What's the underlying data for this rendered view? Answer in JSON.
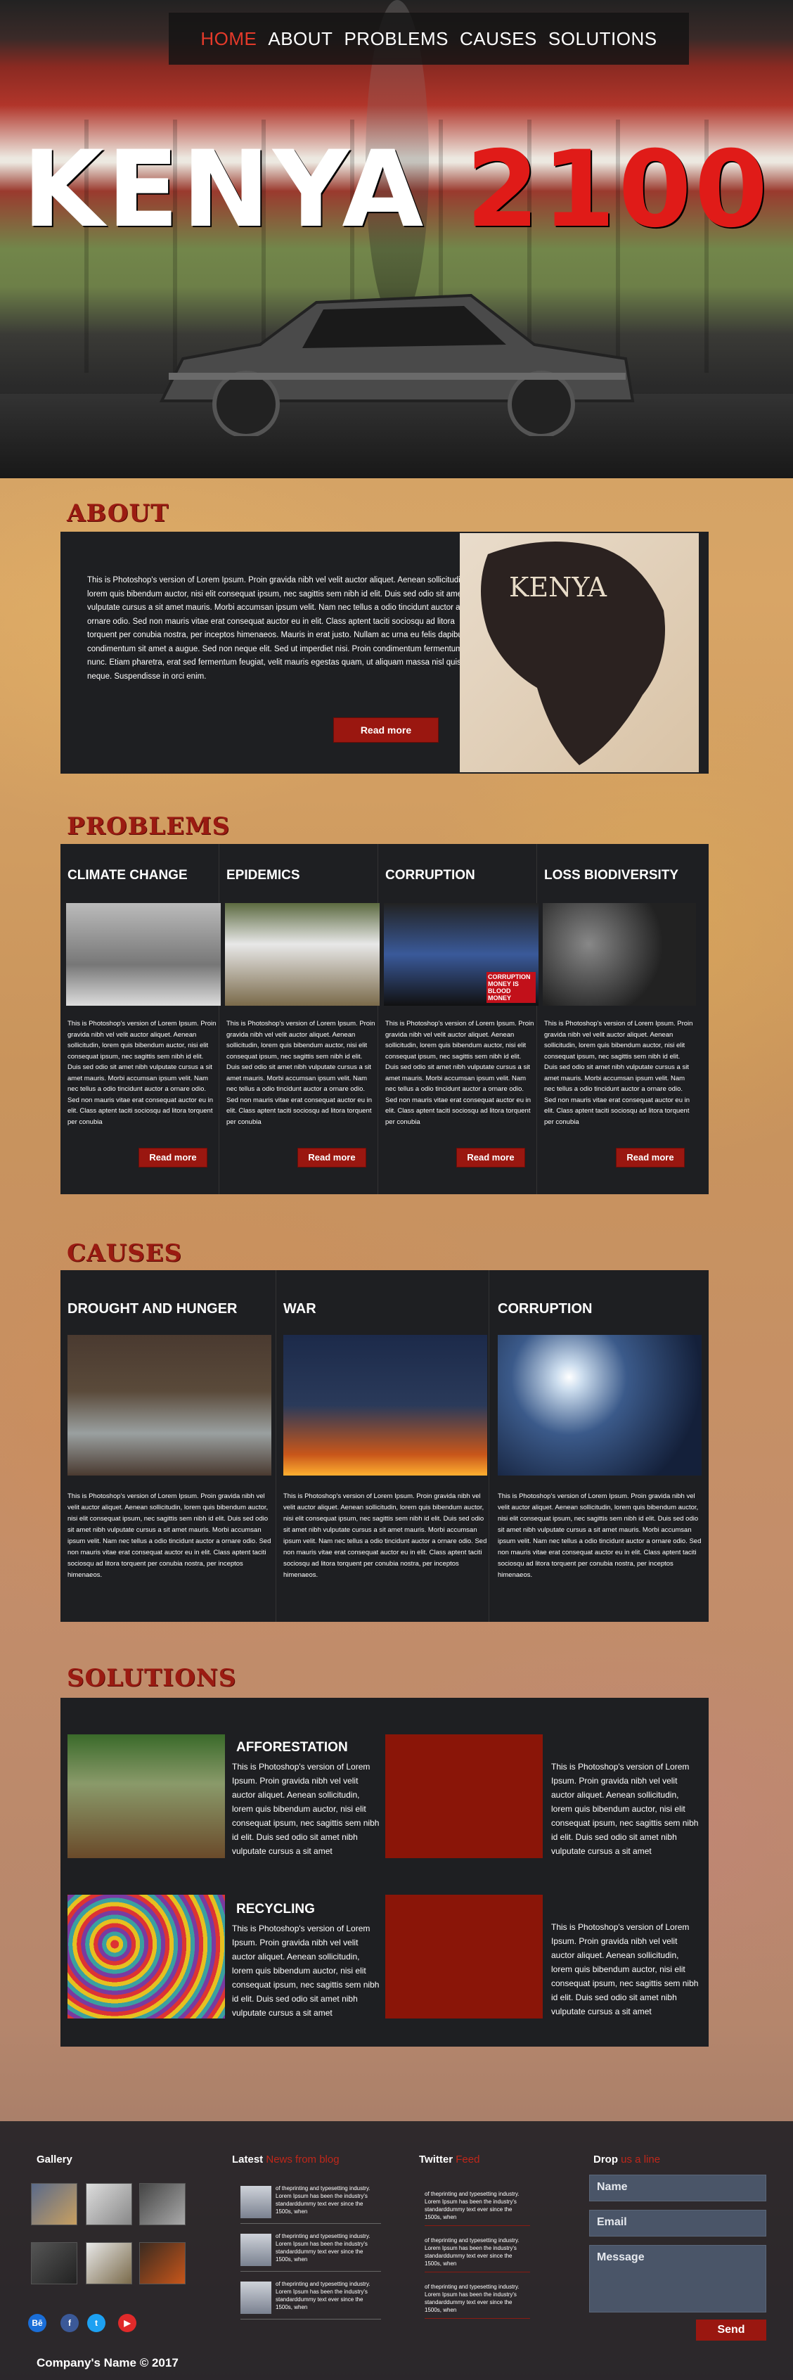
{
  "nav": {
    "items": [
      "HOME",
      "ABOUT",
      "PROBLEMS",
      "CAUSES",
      "SOLUTIONS"
    ],
    "active": "HOME"
  },
  "hero": {
    "title_white": "KENYA",
    "title_red": "2100"
  },
  "about": {
    "heading": "ABOUT",
    "text": "This is Photoshop's version  of Lorem Ipsum. Proin gravida nibh vel velit auctor aliquet. Aenean sollicitudin, lorem quis bibendum auctor, nisi elit consequat ipsum, nec sagittis sem nibh id elit. Duis sed odio sit amet nibh vulputate cursus a sit amet mauris. Morbi accumsan ipsum velit. Nam nec tellus a odio tincidunt auctor a ornare odio. Sed non mauris vitae erat consequat auctor eu in elit. Class aptent taciti sociosqu ad litora torquent per conubia nostra, per inceptos himenaeos. Mauris in erat justo. Nullam ac urna eu felis dapibus condimentum sit amet a augue. Sed non neque elit. Sed ut imperdiet nisi. Proin condimentum fermentum nunc. Etiam pharetra, erat sed fermentum feugiat, velit mauris egestas quam, ut aliquam massa nisl quis neque. Suspendisse in orci enim.",
    "button": "Read more",
    "image_caption": "KENYA"
  },
  "problems": {
    "heading": "PROBLEMS",
    "items": [
      {
        "title": "CLIMATE CHANGE",
        "text": "This is Photoshop's version  of Lorem Ipsum. Proin gravida nibh vel velit auctor aliquet. Aenean sollicitudin, lorem quis bibendum auctor, nisi elit consequat ipsum, nec sagittis sem nibh id elit. Duis sed odio sit amet nibh vulputate cursus a sit amet mauris. Morbi accumsan ipsum velit. Nam nec tellus a odio tincidunt auctor a ornare odio. Sed non  mauris vitae erat consequat auctor eu in elit. Class aptent taciti sociosqu ad litora torquent per conubia",
        "button": "Read more"
      },
      {
        "title": "EPIDEMICS",
        "text": "This is Photoshop's version  of Lorem Ipsum. Proin gravida nibh vel velit auctor aliquet. Aenean sollicitudin, lorem quis bibendum auctor, nisi elit consequat ipsum, nec sagittis sem nibh id elit. Duis sed odio sit amet nibh vulputate cursus a sit amet mauris. Morbi accumsan ipsum velit. Nam nec tellus a odio tincidunt auctor a ornare odio. Sed non  mauris vitae erat consequat auctor eu in elit. Class aptent taciti sociosqu ad litora torquent per conubia",
        "button": "Read more"
      },
      {
        "title": "CORRUPTION",
        "text": "This is Photoshop's version  of Lorem Ipsum. Proin gravida nibh vel velit auctor aliquet. Aenean sollicitudin, lorem quis bibendum auctor, nisi elit consequat ipsum, nec sagittis sem nibh id elit. Duis sed odio sit amet nibh vulputate cursus a sit amet mauris. Morbi accumsan ipsum velit. Nam nec tellus a odio tincidunt auctor a ornare odio. Sed non  mauris vitae erat consequat auctor eu in elit. Class aptent taciti sociosqu ad litora torquent per conubia",
        "button": "Read more",
        "image_text": "CORRUPTION MONEY IS BLOOD MONEY"
      },
      {
        "title": "LOSS BIODIVERSITY",
        "text": "This is Photoshop's version  of Lorem Ipsum. Proin gravida nibh vel velit auctor aliquet. Aenean sollicitudin, lorem quis bibendum auctor, nisi elit consequat ipsum, nec sagittis sem nibh id elit. Duis sed odio sit amet nibh vulputate cursus a sit amet mauris. Morbi accumsan ipsum velit. Nam nec tellus a odio tincidunt auctor a ornare odio. Sed non  mauris vitae erat consequat auctor eu in elit. Class aptent taciti sociosqu ad litora torquent per conubia",
        "button": "Read more"
      }
    ]
  },
  "causes": {
    "heading": "CAUSES",
    "items": [
      {
        "title": "DROUGHT AND HUNGER",
        "text": "This is Photoshop's version  of Lorem Ipsum. Proin gravida nibh vel velit auctor aliquet. Aenean sollicitudin, lorem quis bibendum auctor, nisi elit consequat ipsum, nec sagittis sem nibh id elit. Duis sed odio sit amet nibh vulputate cursus a sit amet mauris. Morbi accumsan ipsum velit. Nam nec tellus a odio tincidunt auctor a ornare odio. Sed non  mauris vitae erat consequat auctor eu in elit. Class aptent taciti sociosqu ad litora torquent per conubia nostra, per inceptos himenaeos."
      },
      {
        "title": "WAR",
        "text": "This is Photoshop's version  of Lorem Ipsum. Proin gravida nibh vel velit auctor aliquet. Aenean sollicitudin, lorem quis bibendum auctor, nisi elit consequat ipsum, nec sagittis sem nibh id elit. Duis sed odio sit amet nibh vulputate cursus a sit amet mauris. Morbi accumsan ipsum velit. Nam nec tellus a odio tincidunt auctor a ornare odio. Sed non  mauris vitae erat consequat auctor eu in elit. Class aptent taciti sociosqu ad litora torquent per conubia nostra, per inceptos himenaeos."
      },
      {
        "title": "CORRUPTION",
        "text": "This is Photoshop's version  of Lorem Ipsum. Proin gravida nibh vel velit auctor aliquet. Aenean sollicitudin, lorem quis bibendum auctor, nisi elit consequat ipsum, nec sagittis sem nibh id elit. Duis sed odio sit amet nibh vulputate cursus a sit amet mauris. Morbi accumsan ipsum velit. Nam nec tellus a odio tincidunt auctor a ornare odio. Sed non  mauris vitae erat consequat auctor eu in elit. Class aptent taciti sociosqu ad litora torquent per conubia nostra, per inceptos himenaeos."
      }
    ]
  },
  "solutions": {
    "heading": "SOLUTIONS",
    "items": [
      {
        "title": "AFFORESTATION",
        "text": "This is Photoshop's version  of Lorem Ipsum. Proin gravida nibh vel velit auctor aliquet. Aenean sollicitudin, lorem quis bibendum auctor, nisi elit consequat ipsum, nec sagittis sem nibh id elit. Duis sed odio sit amet nibh vulputate cursus a sit amet"
      },
      {
        "title": "RECYCLING",
        "text": "This is Photoshop's version  of Lorem Ipsum. Proin gravida nibh vel velit auctor aliquet. Aenean sollicitudin, lorem quis bibendum auctor, nisi elit consequat ipsum, nec sagittis sem nibh id elit. Duis sed odio sit amet nibh vulputate cursus a sit amet"
      }
    ],
    "side_texts": [
      "This is Photoshop's version  of Lorem Ipsum. Proin gravida nibh vel velit auctor aliquet. Aenean sollicitudin, lorem quis bibendum auctor, nisi elit consequat ipsum, nec sagittis sem nibh id elit. Duis sed odio sit amet nibh vulputate cursus a sit amet",
      "This is Photoshop's version  of Lorem Ipsum. Proin gravida nibh vel velit auctor aliquet. Aenean sollicitudin, lorem quis bibendum auctor, nisi elit consequat ipsum, nec sagittis sem nibh id elit. Duis sed odio sit amet nibh vulputate cursus a sit amet"
    ]
  },
  "footer": {
    "gallery_title": "Gallery",
    "latest_title": "Latest",
    "latest_accent": "News from blog",
    "latest_posts": [
      "of theprinting and typesetting industry. Lorem Ipsum has been the industry's standarddummy text ever since the 1500s, when",
      "of theprinting and typesetting industry. Lorem Ipsum has been the industry's standarddummy text ever since the 1500s, when",
      "of theprinting and typesetting industry. Lorem Ipsum has been the industry's standarddummy text ever since the 1500s, when"
    ],
    "twitter_title": "Twitter",
    "twitter_accent": "Feed",
    "tweets": [
      "of theprinting and typesetting industry. Lorem Ipsum has been the industry's standarddummy text ever since the 1500s, when",
      "of theprinting and typesetting industry. Lorem Ipsum has been the industry's standarddummy text ever since the 1500s, when",
      "of theprinting and typesetting industry. Lorem Ipsum has been the industry's standarddummy text ever since the 1500s, when"
    ],
    "drop_title": "Drop",
    "drop_accent": "us a line",
    "form": {
      "name_placeholder": "Name",
      "email_placeholder": "Email",
      "message_placeholder": "Message",
      "send": "Send"
    },
    "social": {
      "behance": "Bē",
      "facebook": "f",
      "twitter": "t",
      "youtube": "▶"
    },
    "copyright": "Company's Name  © 2017"
  },
  "colors": {
    "accent": "#9a1710",
    "panel": "#1e1f22",
    "nav_active": "#e43a2a"
  }
}
